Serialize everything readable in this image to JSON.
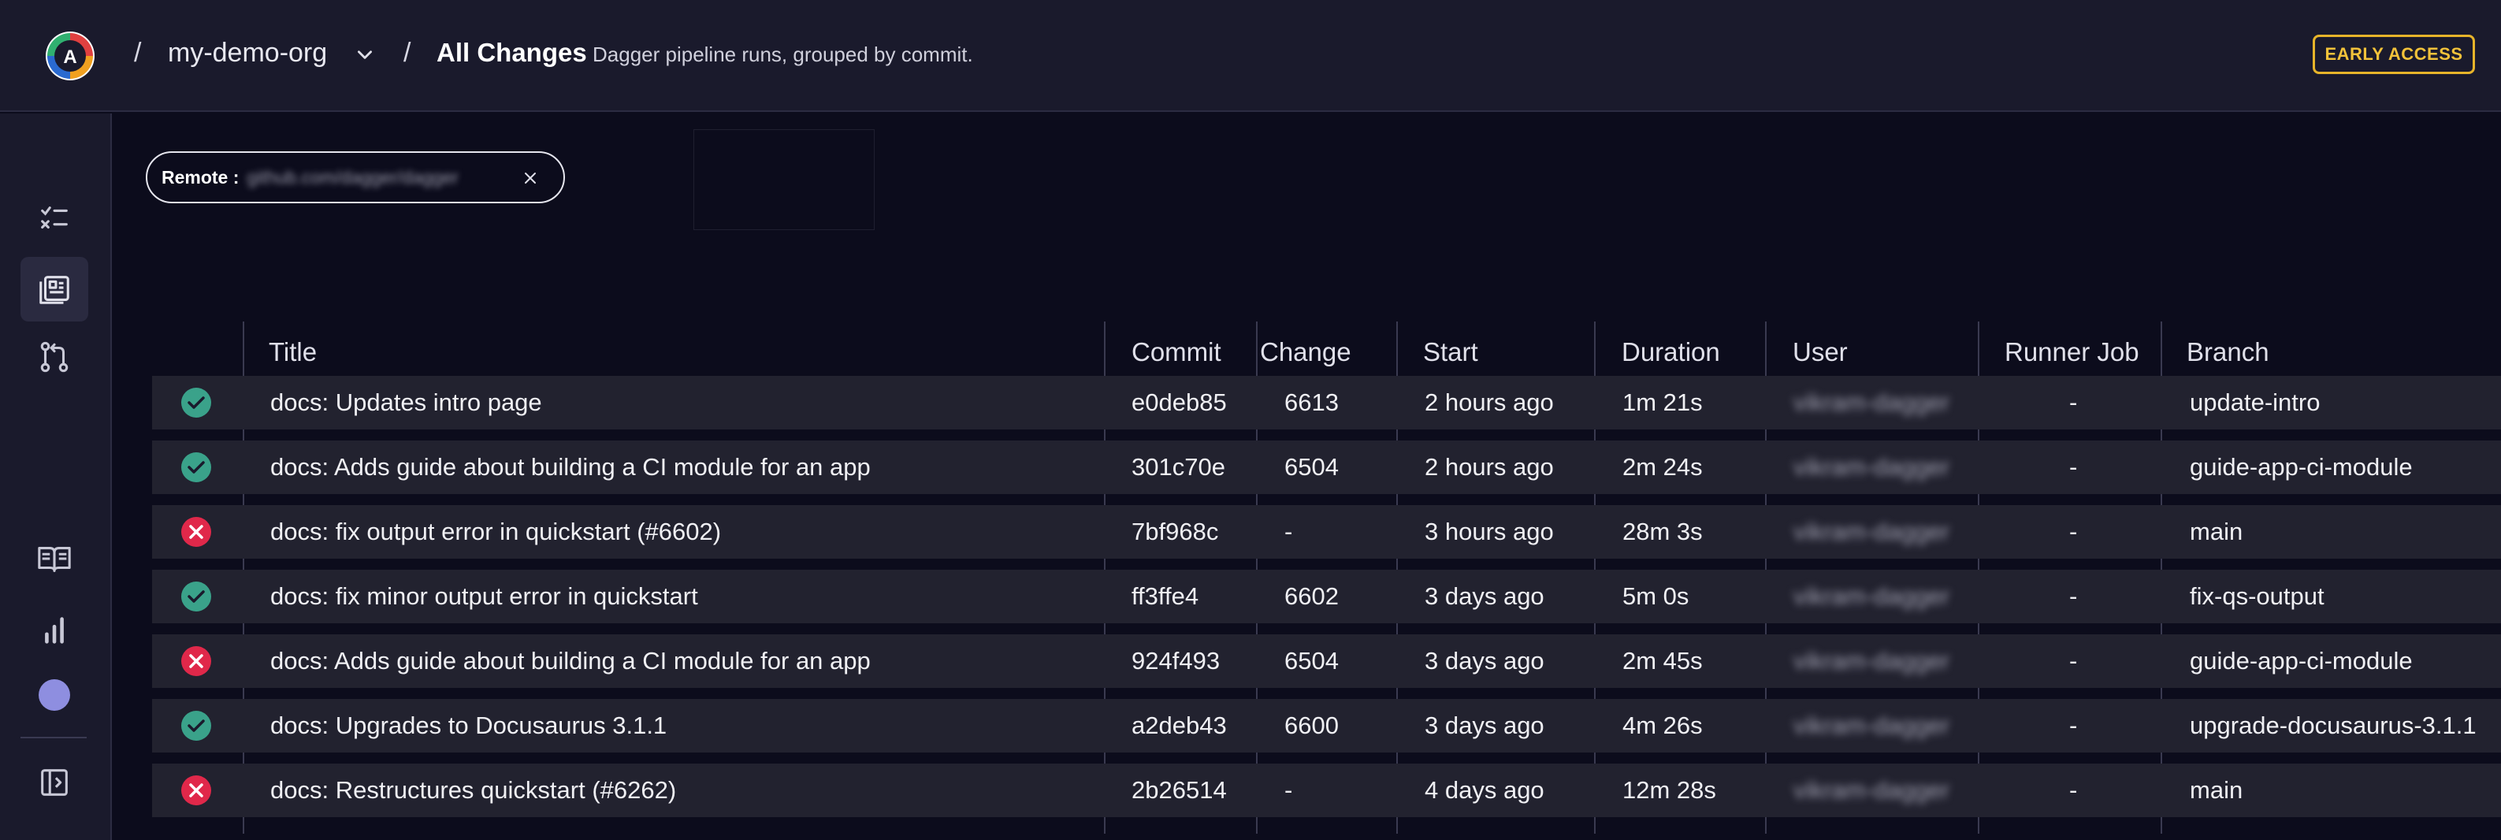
{
  "header": {
    "org_name": "my-demo-org",
    "page_title": "All Changes",
    "page_description": "Dagger pipeline runs, grouped by commit.",
    "separator": "/",
    "early_access_label": "EARLY ACCESS",
    "logo_letter": "A"
  },
  "filter_chip": {
    "label": "Remote :",
    "value": "github.com/dagger/dagger"
  },
  "table": {
    "columns": [
      "Title",
      "Commit",
      "Change",
      "Start",
      "Duration",
      "User",
      "Runner Job",
      "Branch"
    ],
    "rows": [
      {
        "status": "success",
        "title": "docs: Updates intro page",
        "commit": "e0deb85",
        "change": "6613",
        "start": "2 hours ago",
        "duration": "1m 21s",
        "user": "vikram-dagger",
        "runner_job": "-",
        "branch": "update-intro"
      },
      {
        "status": "success",
        "title": "docs: Adds guide about building a CI module for an app",
        "commit": "301c70e",
        "change": "6504",
        "start": "2 hours ago",
        "duration": "2m 24s",
        "user": "vikram-dagger",
        "runner_job": "-",
        "branch": "guide-app-ci-module"
      },
      {
        "status": "failure",
        "title": "docs: fix output error in quickstart (#6602)",
        "commit": "7bf968c",
        "change": "-",
        "start": "3 hours ago",
        "duration": "28m 3s",
        "user": "vikram-dagger",
        "runner_job": "-",
        "branch": "main"
      },
      {
        "status": "success",
        "title": "docs: fix minor output error in quickstart",
        "commit": "ff3ffe4",
        "change": "6602",
        "start": "3 days ago",
        "duration": "5m 0s",
        "user": "vikram-dagger",
        "runner_job": "-",
        "branch": "fix-qs-output"
      },
      {
        "status": "failure",
        "title": "docs: Adds guide about building a CI module for an app",
        "commit": "924f493",
        "change": "6504",
        "start": "3 days ago",
        "duration": "2m 45s",
        "user": "vikram-dagger",
        "runner_job": "-",
        "branch": "guide-app-ci-module"
      },
      {
        "status": "success",
        "title": "docs: Upgrades to Docusaurus 3.1.1",
        "commit": "a2deb43",
        "change": "6600",
        "start": "3 days ago",
        "duration": "4m 26s",
        "user": "vikram-dagger",
        "runner_job": "-",
        "branch": "upgrade-docusaurus-3.1.1"
      },
      {
        "status": "failure",
        "title": "docs: Restructures quickstart (#6262)",
        "commit": "2b26514",
        "change": "-",
        "start": "4 days ago",
        "duration": "12m 28s",
        "user": "vikram-dagger",
        "runner_job": "-",
        "branch": "main"
      }
    ]
  },
  "sidebar": {
    "items": [
      {
        "icon": "checklist-icon"
      },
      {
        "icon": "changes-list-icon",
        "active": true
      },
      {
        "icon": "pull-request-icon"
      },
      {
        "icon": "docs-book-icon"
      },
      {
        "icon": "bar-chart-icon"
      },
      {
        "icon": "status-dot-icon"
      },
      {
        "icon": "collapse-sidebar-icon"
      }
    ]
  },
  "colors": {
    "success": "#3aa28a",
    "failure": "#e0284a",
    "accent_badge": "#e7b42a",
    "row_bg": "#22222f",
    "page_bg": "#0c0c1c"
  }
}
